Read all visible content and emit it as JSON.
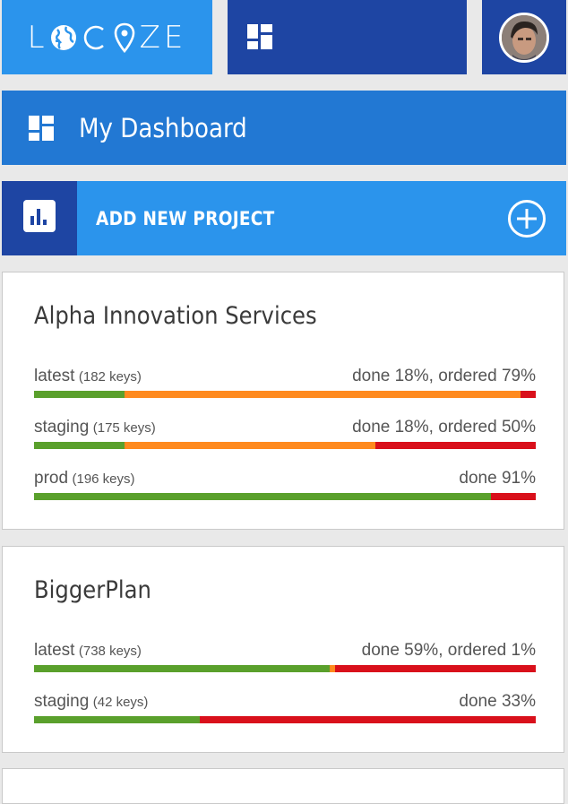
{
  "colors": {
    "accent_light": "#2b94ec",
    "accent_mid": "#2278d3",
    "accent_dark": "#1e45a3",
    "done": "#5aa02c",
    "ordered": "#ff8a1e",
    "remaining": "#d9101b"
  },
  "header": {
    "logo_left": "L",
    "logo_right": "ZE",
    "logo_icons": [
      "globe-icon",
      "c-letter",
      "map-pin-icon"
    ],
    "dashboard_icon": "dashboard-grid-icon",
    "avatar_icon": "user-avatar"
  },
  "nav": {
    "title": "My Dashboard",
    "icon": "dashboard-grid-icon"
  },
  "add_project": {
    "label": "ADD NEW PROJECT",
    "icon": "bar-chart-icon",
    "action_icon": "plus-circle-icon"
  },
  "projects": [
    {
      "name": "Alpha Innovation Services",
      "releases": [
        {
          "name": "latest",
          "keys": "(182 keys)",
          "status": "done 18%, ordered 79%",
          "done": 18,
          "ordered": 79
        },
        {
          "name": "staging",
          "keys": "(175 keys)",
          "status": "done 18%, ordered 50%",
          "done": 18,
          "ordered": 50
        },
        {
          "name": "prod",
          "keys": "(196 keys)",
          "status": "done 91%",
          "done": 91,
          "ordered": 0
        }
      ]
    },
    {
      "name": "BiggerPlan",
      "releases": [
        {
          "name": "latest",
          "keys": "(738 keys)",
          "status": "done 59%, ordered 1%",
          "done": 59,
          "ordered": 1
        },
        {
          "name": "staging",
          "keys": "(42 keys)",
          "status": "done 33%",
          "done": 33,
          "ordered": 0
        }
      ]
    }
  ]
}
